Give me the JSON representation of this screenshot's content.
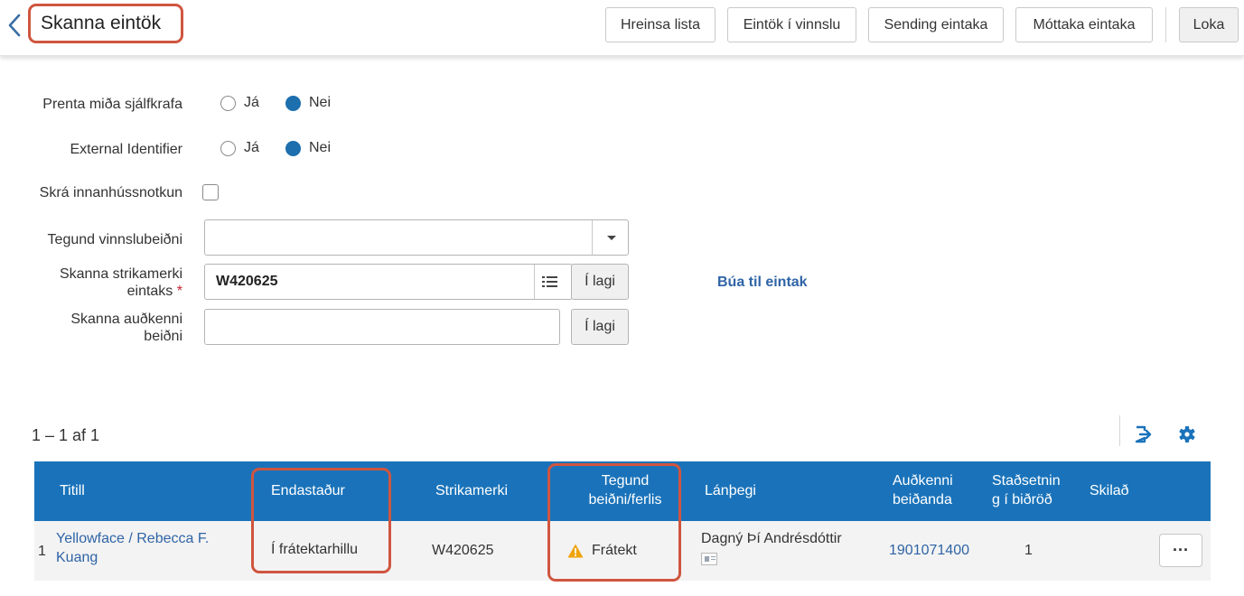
{
  "header": {
    "title": "Skanna eintök",
    "buttons": {
      "clear_list": "Hreinsa lista",
      "items_in_process": "Eintök í vinnslu",
      "send_items": "Sending eintaka",
      "receive_items": "Móttaka eintaka",
      "close": "Loka"
    }
  },
  "form": {
    "auto_print": {
      "label": "Prenta miða sjálfkrafa",
      "yes": "Já",
      "no": "Nei",
      "selected": "Nei"
    },
    "external_identifier": {
      "label": "External Identifier",
      "yes": "Já",
      "no": "Nei",
      "selected": "Nei"
    },
    "register_in_house_use": {
      "label": "Skrá innanhússnotkun",
      "checked": false
    },
    "work_order_type": {
      "label": "Tegund vinnslubeiðni",
      "value": ""
    },
    "scan_item_barcode": {
      "label_line1": "Skanna strikamerki",
      "label_line2": "eintaks",
      "required_mark": "*",
      "value": "W420625",
      "ok": "Í lagi"
    },
    "scan_request_id": {
      "label_line1": "Skanna auðkenni",
      "label_line2": "beiðni",
      "value": "",
      "ok": "Í lagi"
    },
    "create_item_link": "Búa til eintak"
  },
  "table": {
    "count": "1 – 1 af 1",
    "columns": {
      "title": "Titill",
      "destination": "Endastaður",
      "barcode": "Strikamerki",
      "request_type_line1": "Tegund",
      "request_type_line2": "beiðni/ferlis",
      "patron": "Lánþegi",
      "requester_id_line1": "Auðkenni",
      "requester_id_line2": "beiðanda",
      "queue_line1": "Staðsetnin",
      "queue_line2": "g í biðröð",
      "returned": "Skilað"
    },
    "rows": [
      {
        "index": "1",
        "title_line1": "Yellowface / Rebecca F.",
        "title_line2": "Kuang",
        "destination": "Í frátektarhillu",
        "barcode": "W420625",
        "request_type": "Frátekt",
        "patron": "Dagný Þí Andrésdóttir",
        "requester_id": "1901071400",
        "queue_position": "1",
        "returned": "",
        "more": "···"
      }
    ]
  },
  "colors": {
    "accent": "#1a73ba",
    "highlight": "#d0553f",
    "link": "#2f64a6",
    "warning": "#f0a30a"
  }
}
